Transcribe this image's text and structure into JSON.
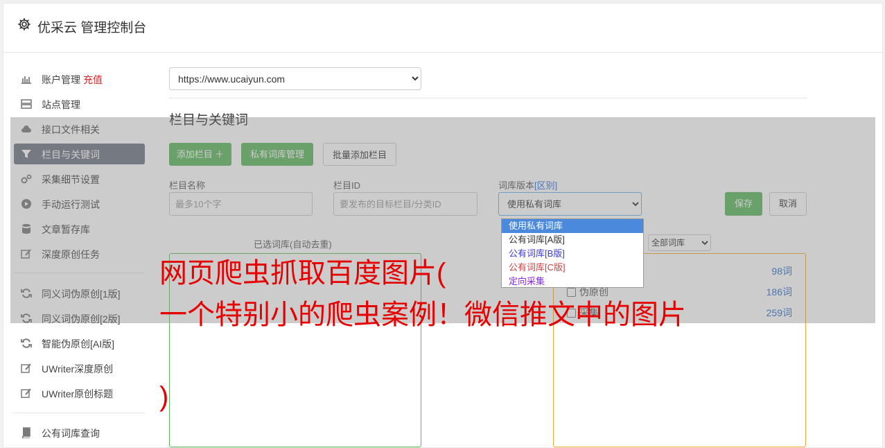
{
  "header": {
    "title": "优采云 管理控制台"
  },
  "sidebar": {
    "items": [
      {
        "label": "账户管理",
        "extra": "充值",
        "icon": "bar-chart-icon"
      },
      {
        "label": "站点管理",
        "icon": "server-icon"
      },
      {
        "label": "接口文件相关",
        "icon": "cloud-upload-icon"
      },
      {
        "label": "栏目与关键词",
        "icon": "filter-icon",
        "active": true
      },
      {
        "label": "采集细节设置",
        "icon": "cogs-icon"
      },
      {
        "label": "手动运行测试",
        "icon": "play-circle-icon"
      },
      {
        "label": "文章暂存库",
        "icon": "database-icon"
      },
      {
        "label": "深度原创任务",
        "icon": "edit-icon"
      },
      {
        "label": "同义词伪原创[1版]",
        "icon": "refresh-icon"
      },
      {
        "label": "同义词伪原创[2版]",
        "icon": "refresh-icon"
      },
      {
        "label": "智能伪原创[AI版]",
        "icon": "refresh-icon"
      },
      {
        "label": "UWriter深度原创",
        "icon": "edit-icon"
      },
      {
        "label": "UWriter原创标题",
        "icon": "edit-icon"
      },
      {
        "label": "公有词库查询",
        "icon": "book-icon"
      }
    ]
  },
  "main": {
    "site_select": "https://www.ucaiyun.com",
    "section_title": "栏目与关键词",
    "buttons": {
      "add_column": "添加栏目 ＋",
      "private_lib": "私有词库管理",
      "batch_add": "批量添加栏目"
    },
    "fields": {
      "name_label": "栏目名称",
      "name_placeholder": "最多10个字",
      "id_label": "栏目ID",
      "id_placeholder": "要发布的目标栏目/分类ID",
      "version_label": "词库版本",
      "version_link": "[区别]",
      "version_value": "使用私有词库"
    },
    "save": "保存",
    "cancel": "取消",
    "dropdown_options": [
      {
        "label": "使用私有词库",
        "color": "#ffffff"
      },
      {
        "label": "公有词库[A版]",
        "color": "#333333"
      },
      {
        "label": "公有词库[B版]",
        "color": "#3a3ad0"
      },
      {
        "label": "公有词库[C版]",
        "color": "#d04040"
      },
      {
        "label": "定向采集",
        "color": "#8a2be2"
      }
    ],
    "selected_panel_title": "已选词库(自动去重)",
    "all_lib_select": "全部词库",
    "word_rows": [
      {
        "name": "",
        "count": "98词"
      },
      {
        "name": "伪原创",
        "count": "186词"
      },
      {
        "name": "采集",
        "count": "259词"
      }
    ]
  },
  "overlay_text": {
    "line1": "网页爬虫抓取百度图片(",
    "line2": "一个特别小的爬虫案例！微信推文中的图片",
    "line3": ")"
  }
}
